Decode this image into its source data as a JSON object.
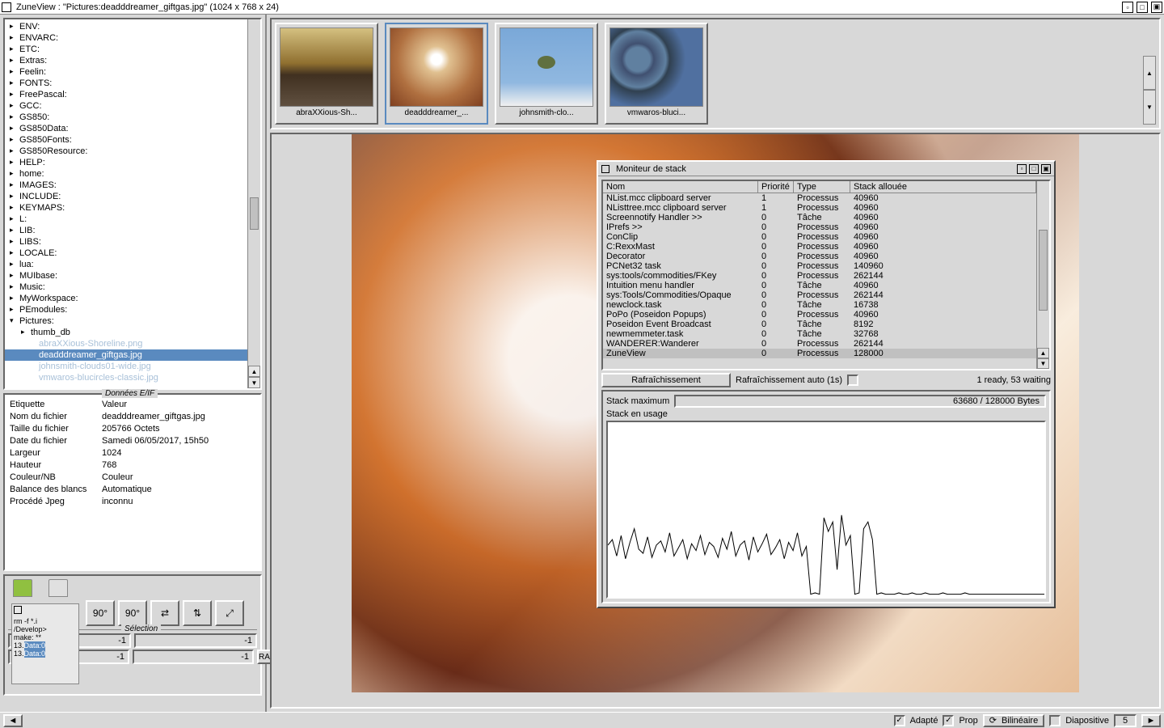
{
  "title": "ZuneView : \"Pictures:deadddreamer_giftgas.jpg\" (1024 x 768 x 24)",
  "tree": [
    "ENV:",
    "ENVARC:",
    "ETC:",
    "Extras:",
    "Feelin:",
    "FONTS:",
    "FreePascal:",
    "GCC:",
    "GS850:",
    "GS850Data:",
    "GS850Fonts:",
    "GS850Resource:",
    "HELP:",
    "home:",
    "IMAGES:",
    "INCLUDE:",
    "KEYMAPS:",
    "L:",
    "LIB:",
    "LIBS:",
    "LOCALE:",
    "lua:",
    "MUIbase:",
    "Music:",
    "MyWorkspace:",
    "PEmodules:"
  ],
  "tree_pictures": "Pictures:",
  "tree_thumb": "thumb_db",
  "tree_files": [
    "abraXXious-Shoreline.png",
    "deadddreamer_giftgas.jpg",
    "johnsmith-clouds01-wide.jpg",
    "vmwaros-blucircles-classic.jpg"
  ],
  "tree_selected_index": 1,
  "exif": {
    "title": "Données E/IF",
    "h_lbl": "Etiquette",
    "h_val": "Valeur",
    "rows": [
      {
        "l": "Nom du fichier",
        "v": "deadddreamer_giftgas.jpg"
      },
      {
        "l": "Taille du fichier",
        "v": "205766 Octets"
      },
      {
        "l": "Date du fichier",
        "v": "Samedi 06/05/2017, 15h50"
      },
      {
        "l": "Largeur",
        "v": "1024"
      },
      {
        "l": "Hauteur",
        "v": "768"
      },
      {
        "l": "Couleur/NB",
        "v": "Couleur"
      },
      {
        "l": "Balance des blancs",
        "v": "Automatique"
      },
      {
        "l": "Procédé Jpeg",
        "v": "inconnu"
      }
    ]
  },
  "thumbs": [
    {
      "label": "abraXXious-Sh..."
    },
    {
      "label": "deadddreamer_..."
    },
    {
      "label": "johnsmith-clo..."
    },
    {
      "label": "vmwaros-bluci..."
    }
  ],
  "monitor": {
    "title": "Moniteur de stack",
    "cols": {
      "nom": "Nom",
      "pri": "Priorité",
      "typ": "Type",
      "stk": "Stack allouée"
    },
    "rows": [
      {
        "n": "NList.mcc clipboard server",
        "p": "1",
        "t": "Processus",
        "s": "40960"
      },
      {
        "n": "NListtree.mcc clipboard server",
        "p": "1",
        "t": "Processus",
        "s": "40960"
      },
      {
        "n": "Screennotify Handler >>",
        "p": "0",
        "t": "Tâche",
        "s": "40960"
      },
      {
        "n": "IPrefs >>",
        "p": "0",
        "t": "Processus",
        "s": "40960"
      },
      {
        "n": "ConClip",
        "p": "0",
        "t": "Processus",
        "s": "40960"
      },
      {
        "n": "C:RexxMast",
        "p": "0",
        "t": "Processus",
        "s": "40960"
      },
      {
        "n": "Decorator",
        "p": "0",
        "t": "Processus",
        "s": "40960"
      },
      {
        "n": "PCNet32 task",
        "p": "0",
        "t": "Processus",
        "s": "140960"
      },
      {
        "n": "sys:tools/commodities/FKey",
        "p": "0",
        "t": "Processus",
        "s": "262144"
      },
      {
        "n": "Intuition menu handler",
        "p": "0",
        "t": "Tâche",
        "s": "40960"
      },
      {
        "n": "sys:Tools/Commodities/Opaque",
        "p": "0",
        "t": "Processus",
        "s": "262144"
      },
      {
        "n": "newclock.task",
        "p": "0",
        "t": "Tâche",
        "s": "16738"
      },
      {
        "n": "PoPo (Poseidon Popups)",
        "p": "0",
        "t": "Processus",
        "s": "40960"
      },
      {
        "n": "Poseidon Event Broadcast",
        "p": "0",
        "t": "Tâche",
        "s": "8192"
      },
      {
        "n": "newmemmeter.task",
        "p": "0",
        "t": "Tâche",
        "s": "32768"
      },
      {
        "n": "WANDERER:Wanderer",
        "p": "0",
        "t": "Processus",
        "s": "262144"
      },
      {
        "n": "ZuneView",
        "p": "0",
        "t": "Processus",
        "s": "128000"
      }
    ],
    "refresh_btn": "Rafraîchissement",
    "auto_label": "Rafraîchissement auto (1s)",
    "status": "1 ready, 53 waiting",
    "stack_max_label": "Stack maximum",
    "stack_max_value": "63680 / 128000 Bytes",
    "stack_use_label": "Stack en usage"
  },
  "toolbox": {
    "rot1": "90°",
    "rot2": "90°",
    "sel_title": "Sélection",
    "v": "-1",
    "raz": "RAZ",
    "term": [
      "rm -f *.i",
      "/Develop>",
      "make: **",
      "13.",
      "13."
    ],
    "term_data": "Data:0"
  },
  "bottom": {
    "adapte": "Adapté",
    "prop": "Prop",
    "interp": "Bilinéaire",
    "diapo": "Diapositive",
    "diapo_n": "5"
  },
  "chart_data": {
    "type": "line",
    "title": "Stack en usage",
    "xlabel": "",
    "ylabel": "",
    "ylim": [
      0,
      128000
    ],
    "note": "noisy time-series oscillating around ~30000-40000 with spikes to ~60000, dropping near 0 in last third with isolated spikes",
    "x": [
      0,
      1,
      2,
      3,
      4,
      5,
      6,
      7,
      8,
      9,
      10,
      11,
      12,
      13,
      14,
      15,
      16,
      17,
      18,
      19,
      20,
      21,
      22,
      23,
      24,
      25,
      26,
      27,
      28,
      29,
      30,
      31,
      32,
      33,
      34,
      35,
      36,
      37,
      38,
      39,
      40,
      41,
      42,
      43,
      44,
      45,
      46,
      47,
      48,
      49,
      50,
      51,
      52,
      53,
      54,
      55,
      56,
      57,
      58,
      59,
      60,
      61,
      62,
      63,
      64,
      65,
      66,
      67,
      68,
      69,
      70,
      71,
      72,
      73,
      74,
      75,
      76,
      77,
      78,
      79,
      80,
      81,
      82,
      83,
      84,
      85,
      86,
      87,
      88,
      89,
      90,
      91,
      92,
      93,
      94,
      95,
      96,
      97,
      98,
      99
    ],
    "values": [
      38000,
      42000,
      30000,
      45000,
      28000,
      40000,
      50000,
      35000,
      32000,
      44000,
      29000,
      38000,
      41000,
      33000,
      47000,
      30000,
      36000,
      42000,
      28000,
      39000,
      34000,
      45000,
      31000,
      40000,
      37000,
      29000,
      43000,
      35000,
      48000,
      30000,
      38000,
      41000,
      27000,
      44000,
      33000,
      39000,
      46000,
      31000,
      36000,
      42000,
      28000,
      40000,
      34000,
      47000,
      30000,
      37000,
      2000,
      3000,
      2000,
      58000,
      48000,
      55000,
      20000,
      60000,
      38000,
      45000,
      2000,
      3000,
      50000,
      55000,
      42000,
      2000,
      3000,
      2000,
      2000,
      2000,
      3000,
      2000,
      2000,
      3000,
      2000,
      2000,
      3000,
      2000,
      2000,
      2000,
      3000,
      2000,
      2000,
      2000,
      2000,
      3000,
      2000,
      2000,
      2000,
      2000,
      2000,
      2000,
      2000,
      2000,
      2000,
      2000,
      2000,
      2000,
      2000,
      2000,
      2000,
      2000,
      2000,
      2000
    ]
  }
}
